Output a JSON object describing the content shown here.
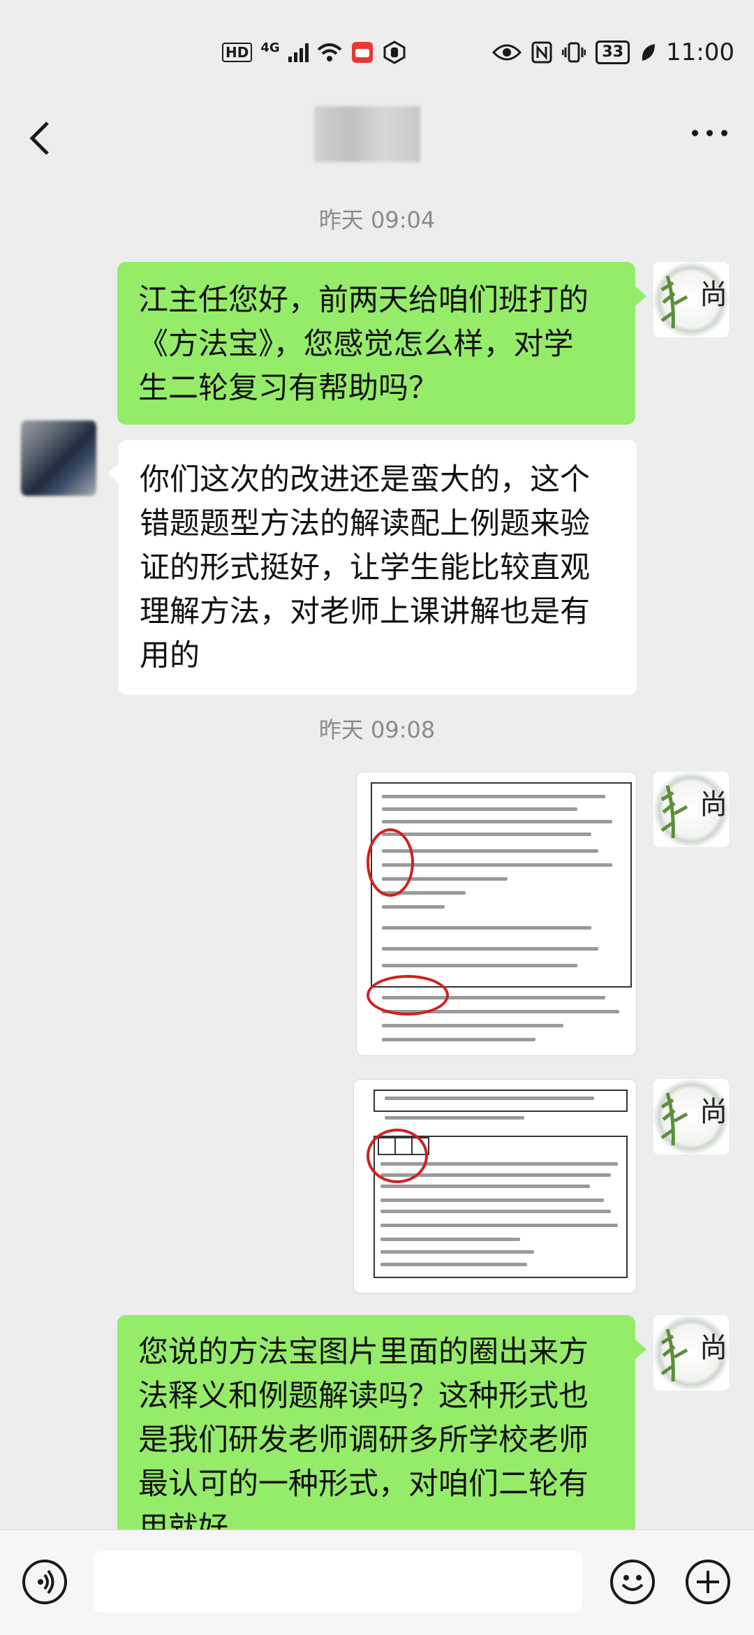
{
  "status_bar": {
    "left_badges": [
      "HD",
      "4G"
    ],
    "battery": "33",
    "time": "11:00"
  },
  "nav": {
    "title": ""
  },
  "messages": [
    {
      "type": "timestamp",
      "text": "昨天 09:04"
    },
    {
      "type": "text",
      "side": "right",
      "lines": [
        "江主任您好，前两天给咱们班打的",
        "《方法宝》，您感觉怎么样，对学",
        "生二轮复习有帮助吗？"
      ]
    },
    {
      "type": "text",
      "side": "left",
      "lines": [
        "你们这次的改进还是蛮大的，这个",
        "错题题型方法的解读配上例题来验",
        "证的形式挺好，让学生能比较直观",
        "理解方法，对老师上课讲解也是有",
        "用的"
      ]
    },
    {
      "type": "timestamp",
      "text": "昨天 09:08"
    },
    {
      "type": "image",
      "side": "right"
    },
    {
      "type": "image",
      "side": "right"
    },
    {
      "type": "text",
      "side": "right",
      "lines": [
        "您说的方法宝图片里面的圈出来方",
        "法释义和例题解读吗？这种形式也",
        "是我们研发老师调研多所学校老师",
        "最认可的一种形式，对咱们二轮有",
        "用就好"
      ]
    }
  ],
  "avatar_me_char": "尚",
  "colors": {
    "sent_bubble": "#95ec69",
    "received_bubble": "#ffffff",
    "background": "#ededed"
  }
}
